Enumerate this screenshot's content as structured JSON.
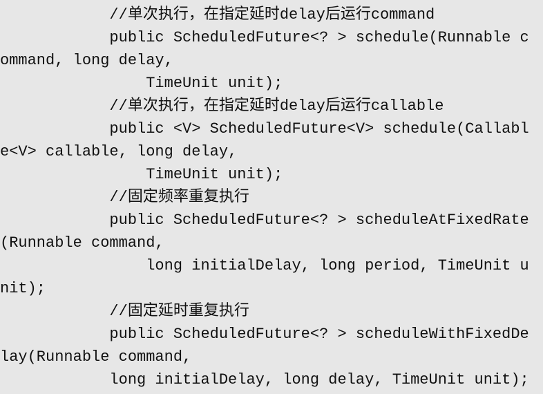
{
  "code": {
    "lines": [
      "            //单次执行，在指定延时delay后运行command",
      "            public ScheduledFuture<? > schedule(Runnable c",
      "ommand, long delay,",
      "                TimeUnit unit);",
      "            //单次执行，在指定延时delay后运行callable",
      "            public <V> ScheduledFuture<V> schedule(Callabl",
      "e<V> callable, long delay,",
      "                TimeUnit unit);",
      "            //固定频率重复执行",
      "            public ScheduledFuture<? > scheduleAtFixedRate",
      "(Runnable command,",
      "                long initialDelay, long period, TimeUnit u",
      "nit);",
      "            //固定延时重复执行",
      "            public ScheduledFuture<? > scheduleWithFixedDe",
      "lay(Runnable command,",
      "            long initialDelay, long delay, TimeUnit unit);"
    ]
  }
}
